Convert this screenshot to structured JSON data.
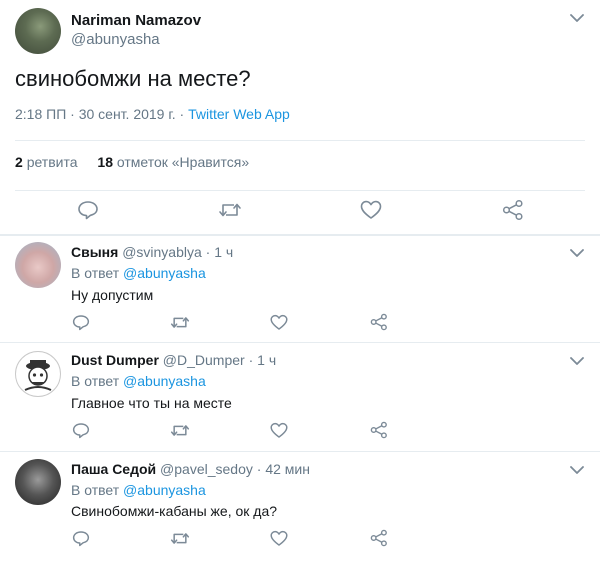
{
  "main": {
    "name": "Nariman Namazov",
    "handle": "@abunyasha",
    "text": "свинобомжи на месте?",
    "time": "2:18 ПП · 30 сент. 2019 г. · ",
    "via": "Twitter Web App",
    "retweets_count": "2",
    "retweets_label": "ретвита",
    "likes_count": "18",
    "likes_label": "отметок «Нравится»"
  },
  "replies": [
    {
      "name": "Свыня",
      "handle": "@svinyablya",
      "time": "1 ч",
      "in_reply_label": "В ответ ",
      "in_reply_to": "@abunyasha",
      "text": "Ну допустим"
    },
    {
      "name": "Dust Dumper",
      "handle": "@D_Dumper",
      "time": "1 ч",
      "in_reply_label": "В ответ ",
      "in_reply_to": "@abunyasha",
      "text": "Главное что ты на месте"
    },
    {
      "name": "Паша Седой",
      "handle": "@pavel_sedoy",
      "time": "42 мин",
      "in_reply_label": "В ответ ",
      "in_reply_to": "@abunyasha",
      "text": "Свинобомжи-кабаны же, ок да?"
    }
  ],
  "separator": " · ",
  "colors": {
    "link": "#1b95e0",
    "secondary": "#657786",
    "icon": "#7c8a97"
  }
}
